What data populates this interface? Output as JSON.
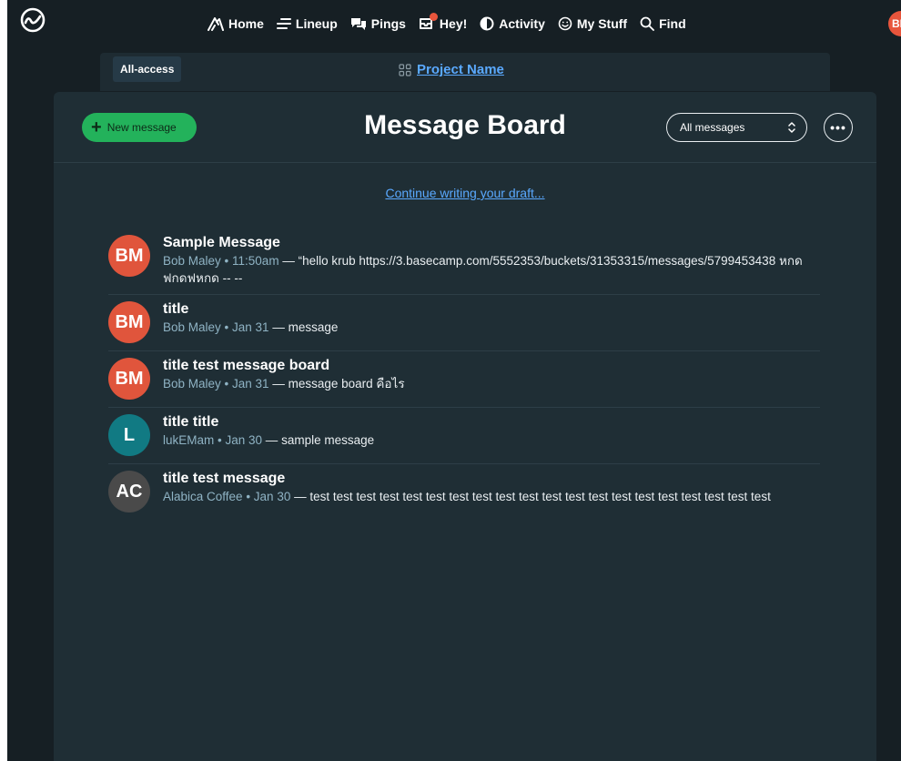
{
  "nav": {
    "items": [
      {
        "label": "Home",
        "icon": "home-icon"
      },
      {
        "label": "Lineup",
        "icon": "lineup-icon"
      },
      {
        "label": "Pings",
        "icon": "pings-icon"
      },
      {
        "label": "Hey!",
        "icon": "hey-icon"
      },
      {
        "label": "Activity",
        "icon": "activity-icon"
      },
      {
        "label": "My Stuff",
        "icon": "mystuff-icon"
      },
      {
        "label": "Find",
        "icon": "search-icon"
      }
    ],
    "user_initials": "BM"
  },
  "project": {
    "access_label": "All-access",
    "name": "Project Name"
  },
  "board": {
    "title": "Message Board",
    "new_message_label": "New message",
    "filter_value": "All messages",
    "more_label": "•••",
    "draft_link": "Continue writing your draft..."
  },
  "messages": [
    {
      "initials": "BM",
      "avatar_color": "#e0553c",
      "title": "Sample Message",
      "author": "Bob Maley",
      "time": "11:50am",
      "excerpt": "“hello krub https://3.basecamp.com/5552353/buckets/31353315/messages/5799453438 หกดฟกดฟหกด -- --"
    },
    {
      "initials": "BM",
      "avatar_color": "#e0553c",
      "title": "title",
      "author": "Bob Maley",
      "time": "Jan 31",
      "excerpt": "message"
    },
    {
      "initials": "BM",
      "avatar_color": "#e0553c",
      "title": "title test message board",
      "author": "Bob Maley",
      "time": "Jan 31",
      "excerpt": "message board คือไร"
    },
    {
      "initials": "L",
      "avatar_color": "#117a83",
      "title": "title title",
      "author": "lukEMam",
      "time": "Jan 30",
      "excerpt": "sample message"
    },
    {
      "initials": "AC",
      "avatar_color": "#4a4a4a",
      "title": "title test message",
      "author": "Alabica Coffee",
      "time": "Jan 30",
      "excerpt": "test test test test test test test test test test test test test test test test test test test test"
    }
  ]
}
